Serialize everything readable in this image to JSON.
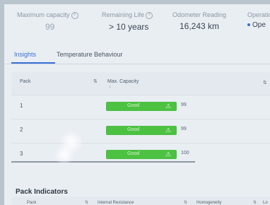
{
  "metrics": [
    {
      "label": "Maximum capacity",
      "value": "99",
      "has_info": true
    },
    {
      "label": "Remaining Life",
      "value": "> 10 years",
      "has_info": true
    },
    {
      "label": "Odometer Reading",
      "value": "16,243 km",
      "has_info": false
    },
    {
      "label": "Operatio",
      "value": "Ope",
      "has_info": false
    }
  ],
  "tabs": [
    {
      "label": "Insights",
      "active": true
    },
    {
      "label": "Temperature Behaviour",
      "active": false
    }
  ],
  "packs_table": {
    "columns": [
      "Pack",
      "Max. Capacity"
    ],
    "rows": [
      {
        "pack": "1",
        "status": "Good",
        "value": "99"
      },
      {
        "pack": "2",
        "status": "Good",
        "value": "99"
      },
      {
        "pack": "3",
        "status": "Good",
        "value": "100"
      }
    ]
  },
  "pack_indicators": {
    "title": "Pack Indicators",
    "columns": [
      "Pack",
      "Internal Resistance",
      "Homogeneity",
      "Lo"
    ]
  },
  "colors": {
    "accent": "#3a6fd8",
    "good": "#4cc142"
  },
  "icons": {
    "info": "info-icon",
    "warning": "warning-icon",
    "sort": "sort-icon"
  }
}
